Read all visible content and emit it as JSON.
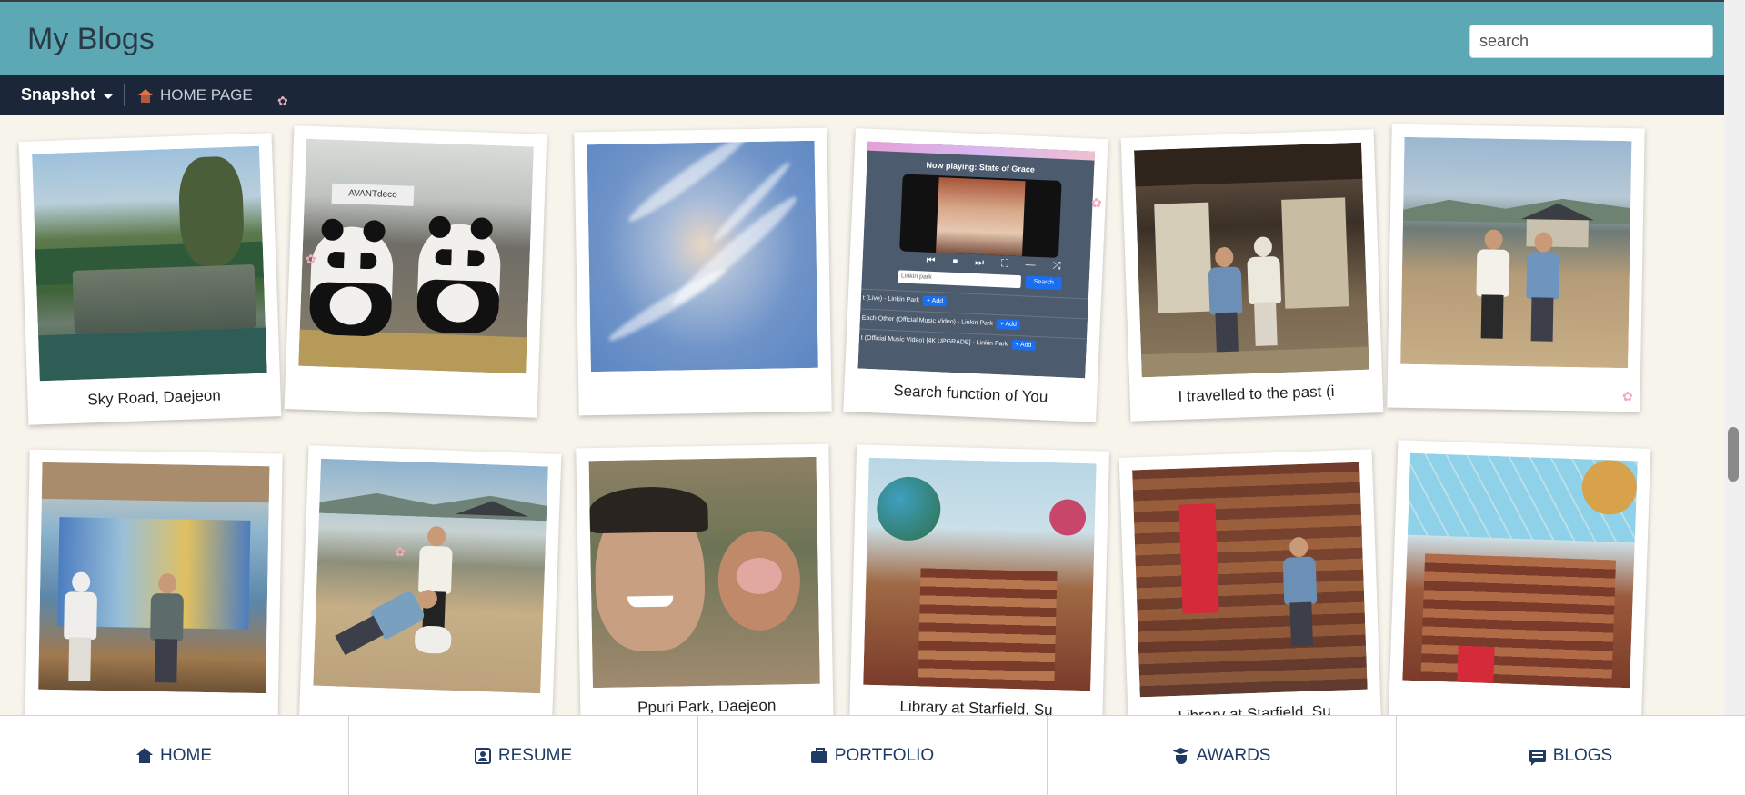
{
  "header": {
    "title": "My Blogs",
    "search_placeholder": "search"
  },
  "nav": {
    "snapshot_label": "Snapshot",
    "home_page_label": "HOME PAGE"
  },
  "posts_row1": [
    {
      "caption": "Sky Road, Daejeon"
    },
    {
      "caption": ""
    },
    {
      "caption": ""
    },
    {
      "caption": "Search function of You"
    },
    {
      "caption": "I travelled to the past (i"
    },
    {
      "caption": ""
    }
  ],
  "posts_row2": [
    {
      "caption": ""
    },
    {
      "caption": ""
    },
    {
      "caption": "Ppuri Park, Daejeon"
    },
    {
      "caption": "Library at Starfield, Su"
    },
    {
      "caption": "Library at Starfield, Su"
    },
    {
      "caption": ""
    }
  ],
  "player_screenshot": {
    "now_playing": "Now playing: State of Grace",
    "input_value": "Linkin park",
    "search_label": "Search",
    "rows": [
      "t (Live) - Linkin Park",
      "Each Other (Official Music Video) - Linkin Park",
      "t (Official Music Video) [4K UPGRADE] - Linkin Park"
    ],
    "add_label": "+ Add",
    "controls": "⏮ ⏹ ⏭ ⛶ — ⤮"
  },
  "shop_sign": "AVANTdeco",
  "bottom_tabs": [
    {
      "label": "HOME",
      "icon": "home-icon"
    },
    {
      "label": "RESUME",
      "icon": "resume-icon"
    },
    {
      "label": "PORTFOLIO",
      "icon": "briefcase-icon"
    },
    {
      "label": "AWARDS",
      "icon": "graduation-cap-icon"
    },
    {
      "label": "BLOGS",
      "icon": "blog-icon"
    }
  ],
  "colors": {
    "header_bg": "#5ca9b5",
    "nav_bg": "#1b2638",
    "page_bg": "#f7f4ec",
    "tab_text": "#1f3a63"
  }
}
